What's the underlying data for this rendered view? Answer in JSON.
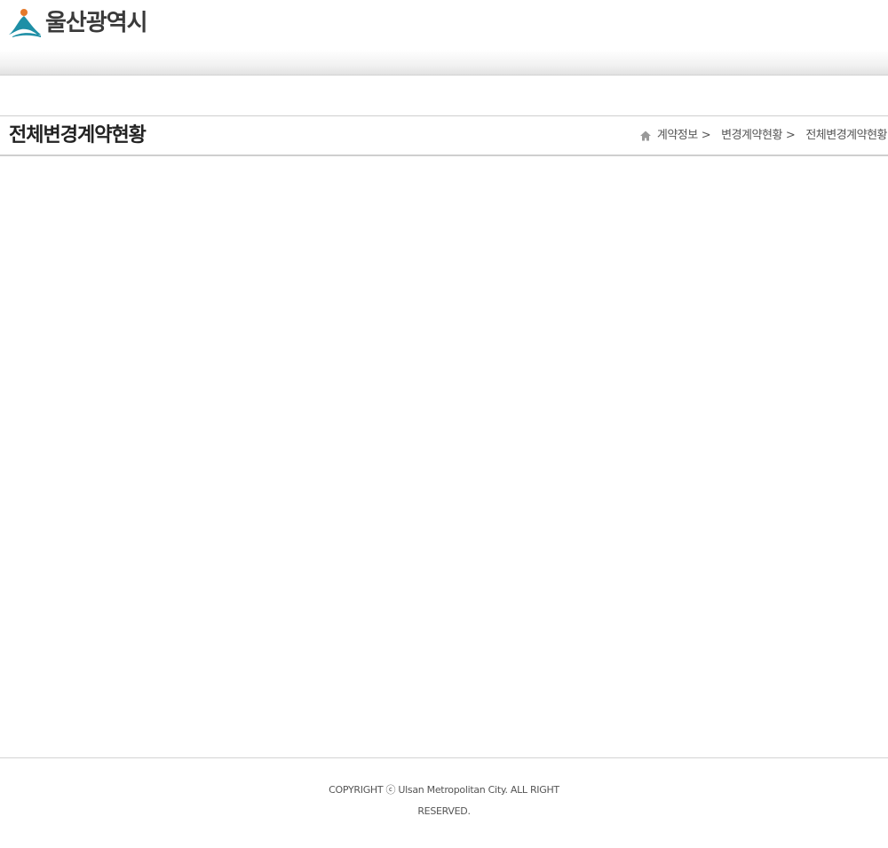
{
  "header": {
    "logo_text": "울산광역시",
    "logo_icon": "ulsan-mountain-logo-icon",
    "colors": {
      "logo_teal": "#1e8fa6",
      "logo_orange": "#e4792b"
    }
  },
  "title_bar": {
    "title": "전체변경계약현황",
    "breadcrumb": {
      "home_icon": "home-icon",
      "items": [
        {
          "label": "계약정보"
        },
        {
          "label": "변경계약현황"
        },
        {
          "label": "전체변경계약현황"
        }
      ],
      "separator": ">"
    }
  },
  "footer": {
    "copyright": "COPYRIGHT ⓒ Ulsan Metropolitan City. ALL RIGHT RESERVED."
  }
}
